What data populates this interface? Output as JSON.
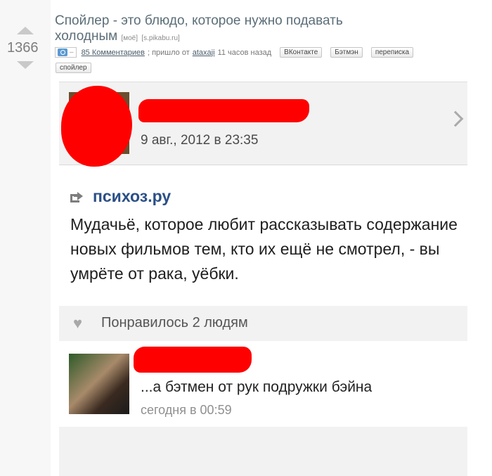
{
  "post": {
    "rating": "1366",
    "title": "Спойлер - это блюдо, которое нужно подавать холодным",
    "mine_link": "[моё]",
    "source": "[s.pikabu.ru]",
    "comments": "85 Комментариев",
    "came_from": "; пришло от",
    "author": "ataxaji",
    "time_ago": "11 часов назад",
    "tags": [
      "ВКонтакте",
      "Бэтмэн",
      "переписка",
      "спойлер"
    ]
  },
  "screenshot": {
    "date": "9 авг., 2012 в 23:35",
    "site": "психоз.ру",
    "text": "Мудачьё, которое любит рассказывать содержание новых фильмов тем, кто их ещё не смотрел, - вы умрёте от рака, уёбки.",
    "likes": "Понравилось 2 людям",
    "comment_text": "...а бэтмен от рук подружки бэйна",
    "comment_date": "сегодня в 00:59"
  },
  "icons": {
    "vote_up": "arrow-up",
    "vote_down": "arrow-down",
    "share": "share-arrow",
    "like": "heart",
    "next": "chevron-right"
  },
  "colors": {
    "censor_red": "#ff0000",
    "link": "#2b4f86",
    "title": "#5b6e78"
  }
}
